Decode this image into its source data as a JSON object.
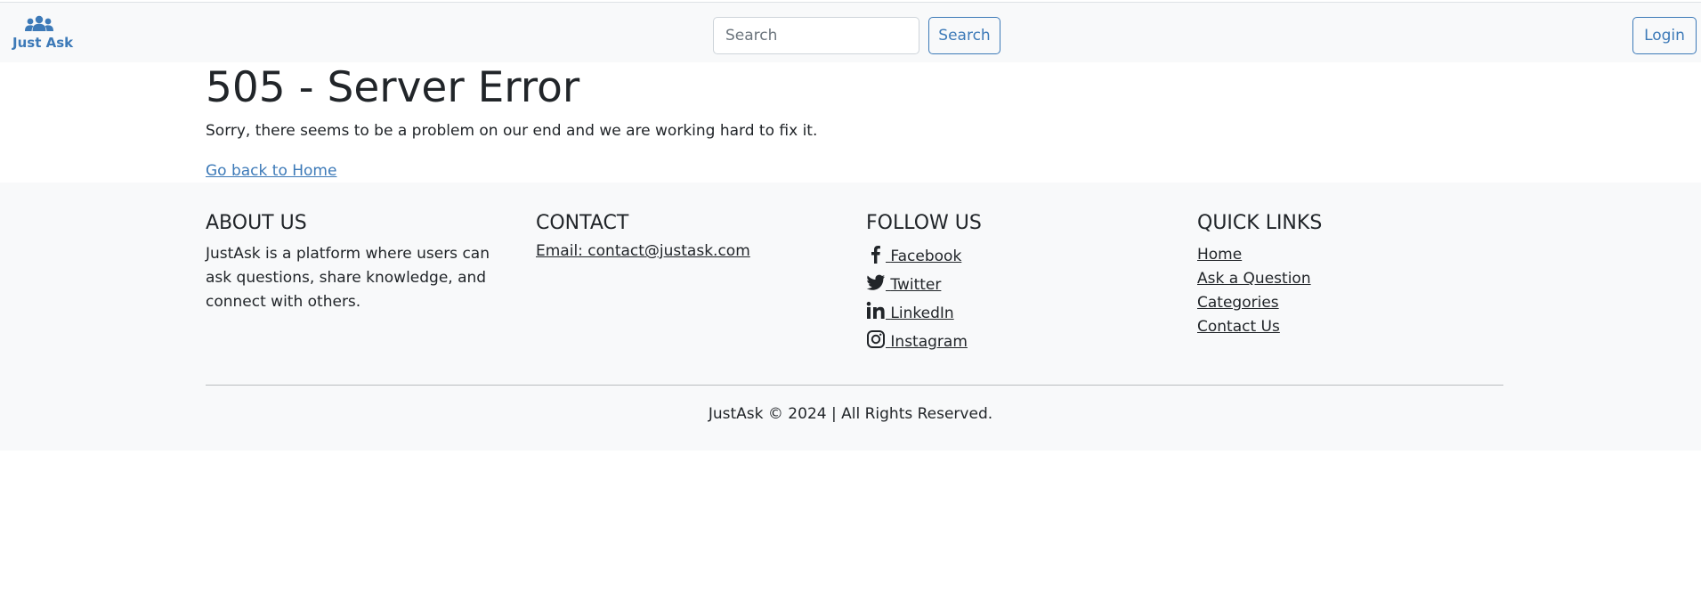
{
  "navbar": {
    "brand": {
      "text": "Just Ask",
      "icon": "users-icon"
    },
    "search": {
      "placeholder": "Search",
      "button_label": "Search"
    },
    "login_label": "Login"
  },
  "main": {
    "title": "505 - Server Error",
    "message": "Sorry, there seems to be a problem on our end and we are working hard to fix it.",
    "home_link": "Go back to Home"
  },
  "footer": {
    "about": {
      "heading": "ABOUT US",
      "text": "JustAsk is a platform where users can ask questions, share knowledge, and connect with others."
    },
    "contact": {
      "heading": "CONTACT",
      "email": "Email: contact@justask.com"
    },
    "follow": {
      "heading": "FOLLOW US",
      "items": [
        {
          "label": "Facebook",
          "icon": "facebook-icon"
        },
        {
          "label": "Twitter",
          "icon": "twitter-icon"
        },
        {
          "label": "LinkedIn",
          "icon": "linkedin-icon"
        },
        {
          "label": "Instagram",
          "icon": "instagram-icon"
        }
      ]
    },
    "quick_links": {
      "heading": "QUICK LINKS",
      "items": [
        "Home",
        "Ask a Question",
        "Categories",
        "Contact Us"
      ]
    },
    "copyright": "JustAsk © 2024 | All Rights Reserved."
  },
  "colors": {
    "brand": "#3d7ab8",
    "text": "#212529",
    "nav_background": "#f8f9fa"
  }
}
